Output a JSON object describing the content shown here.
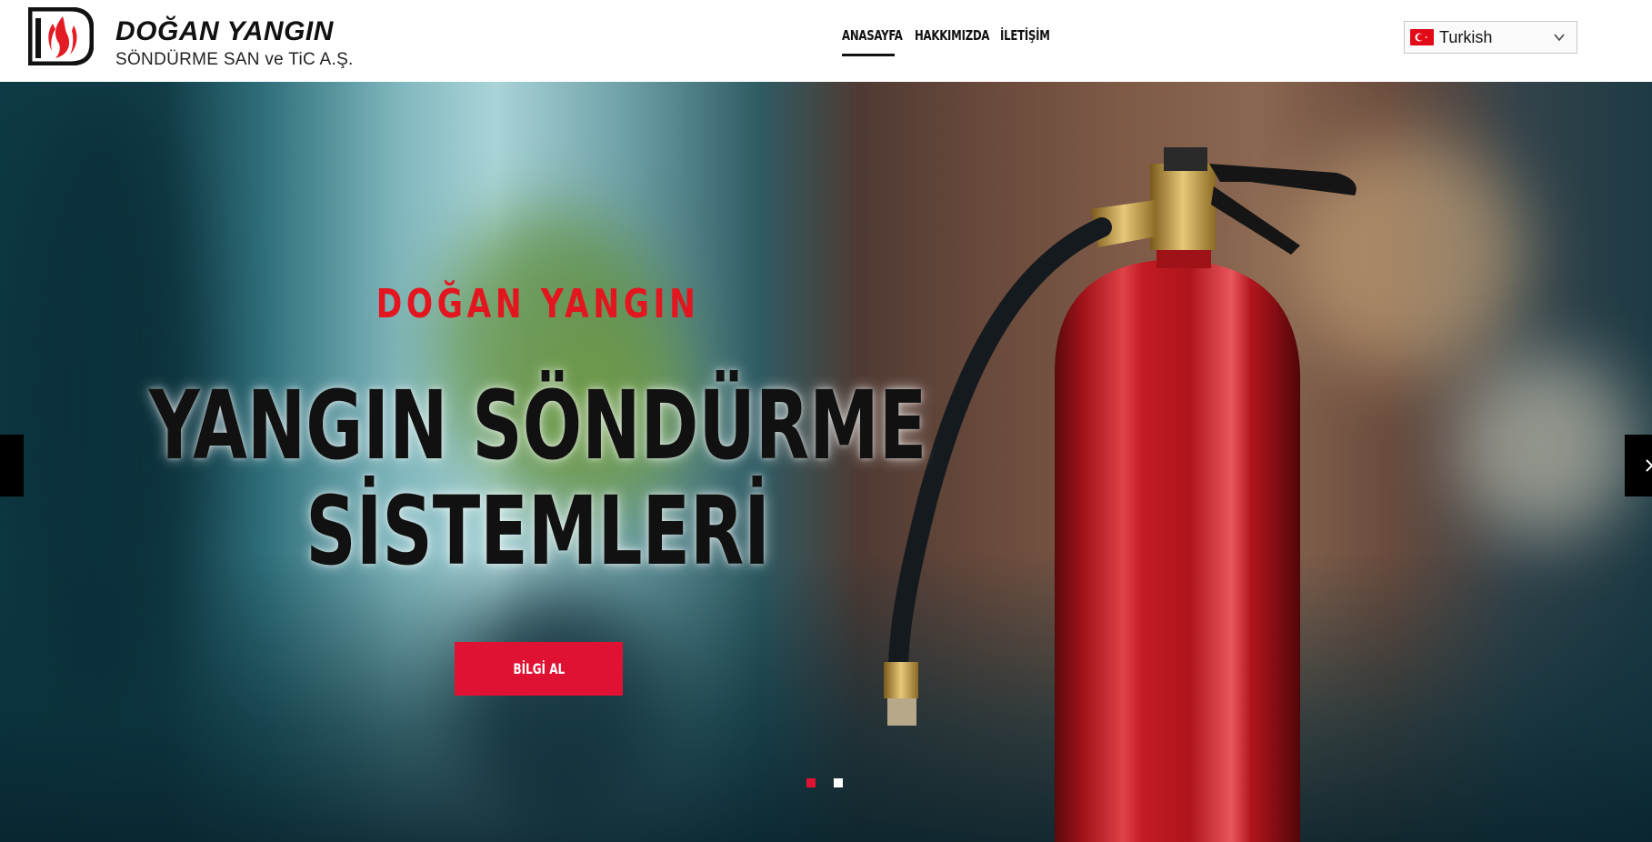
{
  "brand": {
    "title": "DOĞAN YANGIN",
    "subtitle": "SÖNDÜRME SAN ve TiC A.Ş.",
    "logo_icon": "flame-logo-icon"
  },
  "nav": {
    "items": [
      {
        "label": "ANASAYFA",
        "active": true
      },
      {
        "label": "HAKKIMIZDA",
        "active": false
      },
      {
        "label": "İLETİŞİM",
        "active": false
      }
    ]
  },
  "language": {
    "selected": "Turkish",
    "flag_icon": "turkey-flag-icon",
    "chevron_icon": "chevron-down-icon"
  },
  "hero": {
    "kicker": "DOĞAN YANGIN",
    "title_line1": "YANGIN SÖNDÜRME",
    "title_line2": "SİSTEMLERİ",
    "button_label": "BİLGİ AL",
    "slides": 2,
    "active_slide": 1
  },
  "colors": {
    "accent_red": "#e01233",
    "kicker_red": "#e3151f",
    "dot_active": "#e01233",
    "dot_inactive": "#ffffff"
  }
}
